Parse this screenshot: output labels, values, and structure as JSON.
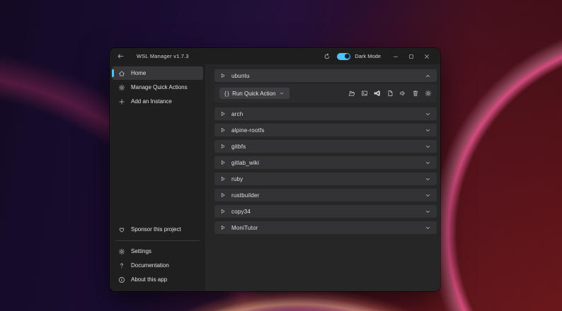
{
  "titlebar": {
    "title": "WSL Manager v1.7.3",
    "back_icon": "back-arrow",
    "refresh_icon": "refresh",
    "dark_mode_label": "Dark Mode",
    "dark_mode_on": true,
    "controls": [
      "minimize",
      "maximize",
      "close"
    ]
  },
  "sidebar": {
    "nav": [
      {
        "label": "Home",
        "icon": "home",
        "selected": true
      },
      {
        "label": "Manage Quick Actions",
        "icon": "gear",
        "selected": false
      },
      {
        "label": "Add an Instance",
        "icon": "plus",
        "selected": false
      }
    ],
    "footer_primary": [
      {
        "label": "Sponsor this project",
        "icon": "heart"
      }
    ],
    "footer_secondary": [
      {
        "label": "Settings",
        "icon": "gear"
      },
      {
        "label": "Documentation",
        "icon": "question"
      },
      {
        "label": "About this app",
        "icon": "info"
      }
    ]
  },
  "main": {
    "expanded_instance": {
      "name": "ubuntu",
      "quick_action": {
        "icon": "braces",
        "label": "Run Quick Action"
      },
      "actions": [
        {
          "name": "open-folder",
          "icon": "folder-open"
        },
        {
          "name": "open-terminal",
          "icon": "terminal"
        },
        {
          "name": "open-vscode",
          "icon": "vscode"
        },
        {
          "name": "copy",
          "icon": "copy"
        },
        {
          "name": "export",
          "icon": "speaker"
        },
        {
          "name": "delete",
          "icon": "trash"
        },
        {
          "name": "instance-settings",
          "icon": "gear"
        }
      ]
    },
    "instances": [
      "arch",
      "alpine-rootfs",
      "gitbfs",
      "gitlab_wiki",
      "ruby",
      "rustbuilder",
      "copy34",
      "MoniTutor"
    ]
  },
  "colors": {
    "accent": "#4cc2ff",
    "titlebar_bg": "#1e1e1e",
    "sidebar_bg": "#1f1f1f",
    "main_bg": "#262626",
    "row_bg": "#333336"
  }
}
